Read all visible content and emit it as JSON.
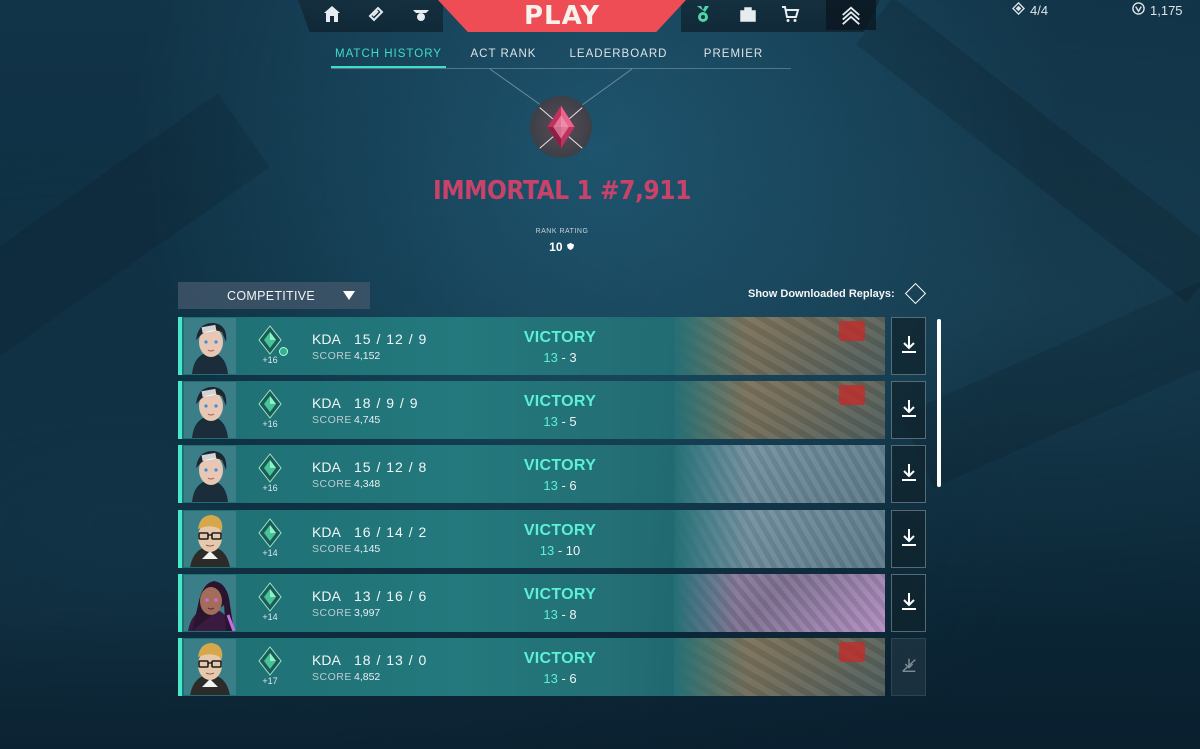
{
  "topnav": {
    "play_label": "PLAY",
    "icons": [
      "home-icon",
      "battlepass-icon",
      "agents-icon",
      "career-icon",
      "collection-icon",
      "store-icon",
      "rank-icon"
    ]
  },
  "currency": {
    "radianite": "4/4",
    "valorant_points": "1,175"
  },
  "subtabs": [
    {
      "label": "MATCH HISTORY",
      "active": true
    },
    {
      "label": "ACT RANK",
      "active": false
    },
    {
      "label": "LEADERBOARD",
      "active": false
    },
    {
      "label": "PREMIER",
      "active": false
    }
  ],
  "rank": {
    "title": "IMMORTAL 1 #7,911",
    "rr_label": "RANK RATING",
    "rr_value": "10"
  },
  "filter": {
    "mode": "COMPETITIVE",
    "replays_label": "Show Downloaded Replays:"
  },
  "matches": [
    {
      "agent": "jett",
      "rr_gain": "+16",
      "kda_label": "KDA",
      "kda": "15 / 12 / 9",
      "score_label": "SCORE",
      "score": "4,152",
      "result": "VICTORY",
      "team_score": "13",
      "enemy_score": "3",
      "map": "sunset",
      "download": true,
      "rank_up": true
    },
    {
      "agent": "jett",
      "rr_gain": "+16",
      "kda_label": "KDA",
      "kda": "18 / 9 / 9",
      "score_label": "SCORE",
      "score": "4,745",
      "result": "VICTORY",
      "team_score": "13",
      "enemy_score": "5",
      "map": "sunset",
      "download": true,
      "rank_up": false
    },
    {
      "agent": "jett",
      "rr_gain": "+16",
      "kda_label": "KDA",
      "kda": "15 / 12 / 8",
      "score_label": "SCORE",
      "score": "4,348",
      "result": "VICTORY",
      "team_score": "13",
      "enemy_score": "6",
      "map": "breeze",
      "download": true,
      "rank_up": false
    },
    {
      "agent": "chamber",
      "rr_gain": "+14",
      "kda_label": "KDA",
      "kda": "16 / 14 / 2",
      "score_label": "SCORE",
      "score": "4,145",
      "result": "VICTORY",
      "team_score": "13",
      "enemy_score": "10",
      "map": "breeze",
      "download": true,
      "rank_up": false
    },
    {
      "agent": "reyna",
      "rr_gain": "+14",
      "kda_label": "KDA",
      "kda": "13 / 16 / 6",
      "score_label": "SCORE",
      "score": "3,997",
      "result": "VICTORY",
      "team_score": "13",
      "enemy_score": "8",
      "map": "lotus",
      "download": true,
      "rank_up": false
    },
    {
      "agent": "chamber",
      "rr_gain": "+17",
      "kda_label": "KDA",
      "kda": "18 / 13 / 0",
      "score_label": "SCORE",
      "score": "4,852",
      "result": "VICTORY",
      "team_score": "13",
      "enemy_score": "6",
      "map": "sunset",
      "download": false,
      "rank_up": false
    }
  ],
  "colors": {
    "accent": "#47e8c8",
    "victory": "#5cf1d6",
    "play": "#ef4d56",
    "rank_title": "#c8426a"
  }
}
